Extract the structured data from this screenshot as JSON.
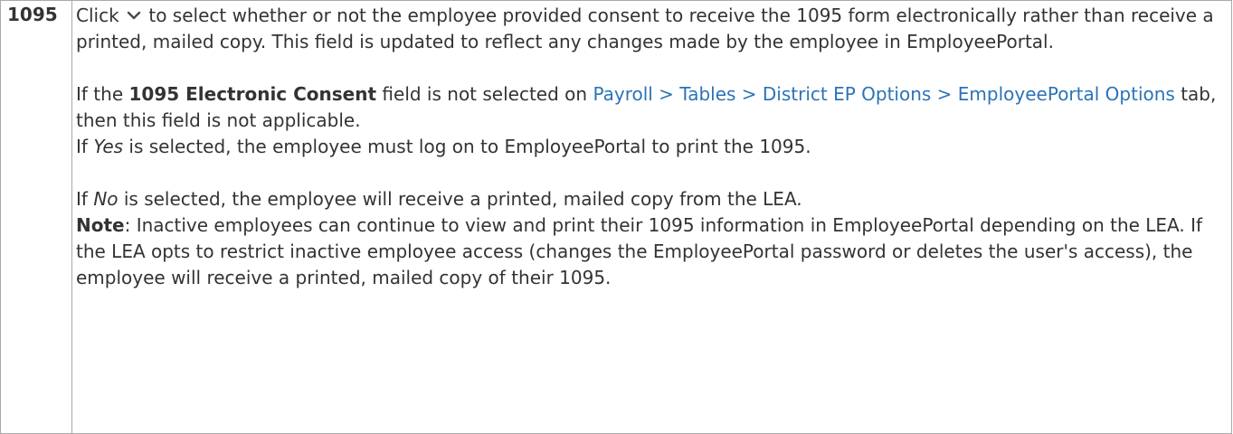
{
  "field": {
    "label": "1095"
  },
  "desc": {
    "click_word": "Click",
    "chevron_icon": "chevron-down-icon",
    "p1_rest": "to select whether or not the employee provided consent to receive the 1095 form electronically rather than receive a printed, mailed copy. This field is updated to reflect any changes made by the employee in EmployeePortal.",
    "p2_lead": "If the",
    "p2_bold": "1095 Electronic Consent",
    "p2_mid": "field is not selected on",
    "p2_link": "Payroll > Tables > District EP Options > EmployeePortal Options",
    "p2_tail": "tab, then this field is not applicable.",
    "p3_lead": "If",
    "p3_em": "Yes",
    "p3_rest": "is selected, the employee must log on to EmployeePortal to print the 1095.",
    "p4_lead": "If",
    "p4_em": "No",
    "p4_rest": "is selected, the employee will receive a printed, mailed copy from the LEA.",
    "note_label": "Note",
    "note_text": ": Inactive employees can continue to view and print their 1095 information in EmployeePortal depending on the LEA. If the LEA opts to restrict inactive employee access (changes the EmployeePortal password or deletes the user's access), the employee will receive a printed, mailed copy of their 1095."
  },
  "colors": {
    "text": "#333333",
    "link": "#2b73b7",
    "border": "#a9a9a9"
  }
}
